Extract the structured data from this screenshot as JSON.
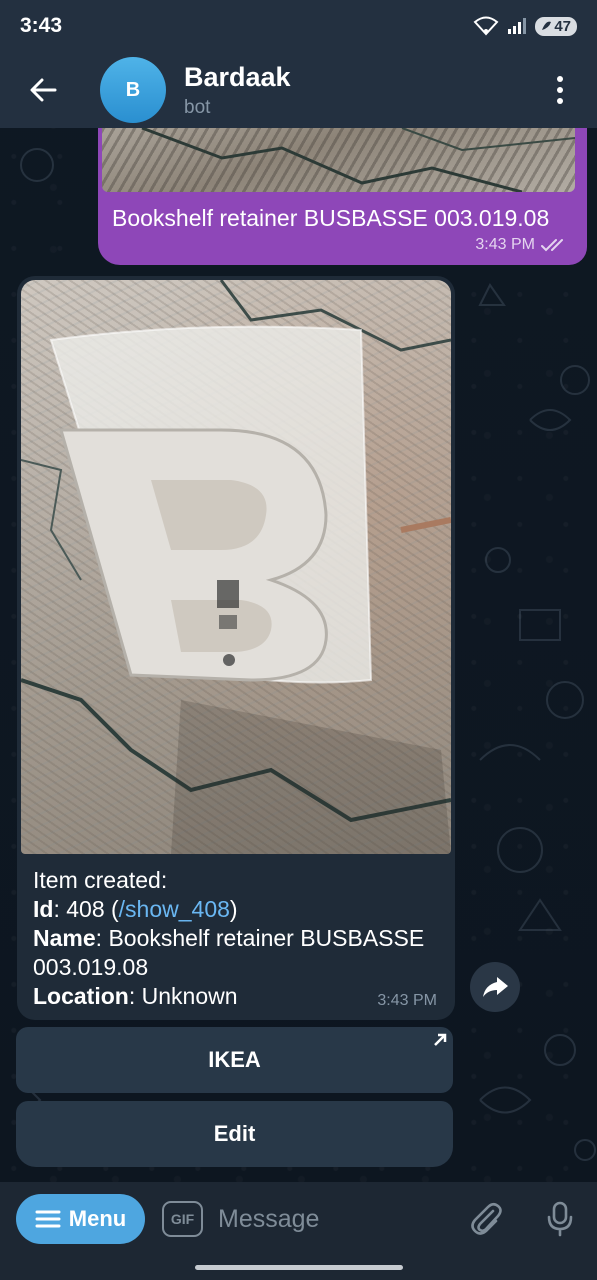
{
  "status_bar": {
    "time": "3:43",
    "battery": "47"
  },
  "chat": {
    "avatar_letter": "B",
    "title": "Bardaak",
    "subtitle": "bot"
  },
  "outgoing": {
    "text": "Bookshelf retainer BUSBASSE 003.019.08",
    "time": "3:43 PM"
  },
  "incoming": {
    "line1": "Item created:",
    "id_label": "Id",
    "id_value": "408",
    "command": "/show_408",
    "name_label": "Name",
    "name_value": "Bookshelf retainer BUSBASSE 003.019.08",
    "location_label": "Location",
    "location_value": "Unknown",
    "time": "3:43 PM"
  },
  "keyboard": {
    "button1": "IKEA",
    "button2": "Edit"
  },
  "composer": {
    "menu_label": "Menu",
    "gif_label": "GIF",
    "placeholder": "Message"
  },
  "colors": {
    "header": "#233040",
    "outgoing_bubble": "#8e47b8",
    "incoming_bubble": "#1f2b38",
    "link": "#6ab7f2",
    "menu_button": "#4ea6e0"
  }
}
